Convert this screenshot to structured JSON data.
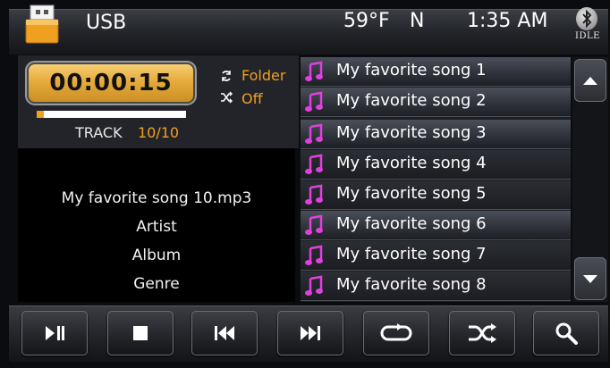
{
  "status_bar": {
    "source_label": "USB",
    "temperature": "59°F",
    "compass_direction": "N",
    "time": "1:35 AM",
    "bluetooth_status": "IDLE"
  },
  "player": {
    "elapsed_time": "00:00:15",
    "progress_fraction": 0.05,
    "track_label": "TRACK",
    "track_number": "10/10",
    "repeat_mode": "Folder",
    "shuffle_mode": "Off",
    "current_file": "My favorite song 10.mp3",
    "artist": "Artist",
    "album": "Album",
    "genre": "Genre"
  },
  "playlist": {
    "items": [
      {
        "title": "My favorite song 1"
      },
      {
        "title": "My favorite song 2"
      },
      {
        "title": "My favorite song 3"
      },
      {
        "title": "My favorite song 4"
      },
      {
        "title": "My favorite song 5"
      },
      {
        "title": "My favorite song 6"
      },
      {
        "title": "My favorite song 7"
      },
      {
        "title": "My favorite song 8"
      }
    ]
  },
  "controls": [
    {
      "name": "play-pause-button",
      "icon": "play-pause-icon"
    },
    {
      "name": "stop-button",
      "icon": "stop-icon"
    },
    {
      "name": "previous-track-button",
      "icon": "previous-icon"
    },
    {
      "name": "next-track-button",
      "icon": "next-icon"
    },
    {
      "name": "repeat-button",
      "icon": "repeat-icon"
    },
    {
      "name": "shuffle-button",
      "icon": "shuffle-icon"
    },
    {
      "name": "search-button",
      "icon": "search-icon"
    }
  ],
  "colors": {
    "accent_orange": "#f0a020",
    "timer_gold": "#e6ab3c",
    "note_magenta": "#e040e0"
  }
}
